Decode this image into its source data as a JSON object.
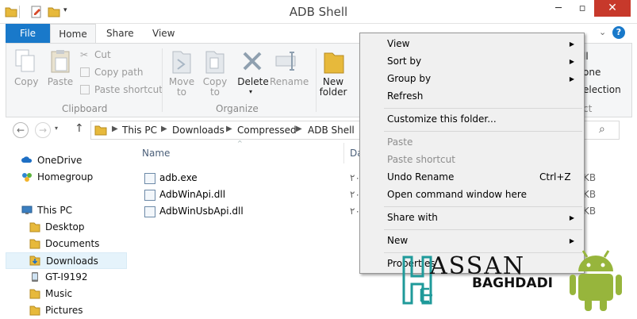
{
  "window": {
    "title": "ADB Shell"
  },
  "ribbon": {
    "tabs": {
      "file": "File",
      "home": "Home",
      "share": "Share",
      "view": "View"
    },
    "clipboard": {
      "copy": "Copy",
      "paste": "Paste",
      "cut": "Cut",
      "copy_path": "Copy path",
      "paste_shortcut": "Paste shortcut",
      "group": "Clipboard"
    },
    "organize": {
      "move_to": "Move\nto",
      "copy_to": "Copy\nto",
      "delete": "Delete",
      "rename": "Rename",
      "group": "Organize"
    },
    "new": {
      "new_folder": "New\nfolder"
    },
    "partial": {
      "all": "ll",
      "none": "one",
      "selection": "election",
      "group_tail": "ct"
    }
  },
  "address": {
    "crumbs": [
      "This PC",
      "Downloads",
      "Compressed",
      "ADB Shell"
    ]
  },
  "nav": {
    "items": [
      {
        "label": "OneDrive",
        "icon": "cloud-icon"
      },
      {
        "label": "Homegroup",
        "icon": "homegroup-icon"
      },
      {
        "label": "This PC",
        "icon": "computer-icon"
      },
      {
        "label": "Desktop",
        "icon": "folder-icon"
      },
      {
        "label": "Documents",
        "icon": "folder-icon"
      },
      {
        "label": "Downloads",
        "icon": "downloads-folder-icon",
        "selected": true
      },
      {
        "label": "GT-I9192",
        "icon": "phone-icon"
      },
      {
        "label": "Music",
        "icon": "folder-icon"
      },
      {
        "label": "Pictures",
        "icon": "folder-icon"
      }
    ]
  },
  "files": {
    "columns": {
      "name": "Name",
      "date": "Da"
    },
    "rows": [
      {
        "name": "adb.exe",
        "date": "٢٠",
        "size": "KB",
        "icon": "exe-icon"
      },
      {
        "name": "AdbWinApi.dll",
        "date": "٢٠",
        "size": "KB",
        "icon": "dll-icon"
      },
      {
        "name": "AdbWinUsbApi.dll",
        "date": "٢٠",
        "size": "KB",
        "icon": "dll-icon"
      }
    ]
  },
  "context_menu": {
    "view": "View",
    "sort_by": "Sort by",
    "group_by": "Group by",
    "refresh": "Refresh",
    "customize": "Customize this folder...",
    "paste": "Paste",
    "paste_shortcut": "Paste shortcut",
    "undo_rename": "Undo Rename",
    "undo_shortcut": "Ctrl+Z",
    "open_cmd": "Open command window here",
    "share_with": "Share with",
    "new": "New",
    "properties": "Properties"
  },
  "watermark": {
    "hassan": "ASSAN",
    "baghdadi": "BAGHDADI"
  },
  "colors": {
    "accent": "#1979ca",
    "close": "#c7392b",
    "selected": "#e5f3fb",
    "watermark_teal": "#1f9a9a",
    "android_green": "#97b53c"
  }
}
